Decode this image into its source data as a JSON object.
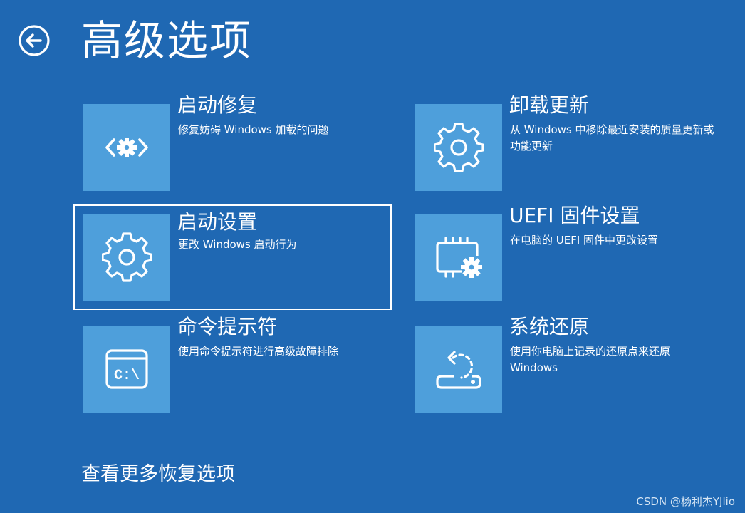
{
  "header": {
    "title": "高级选项",
    "back_icon": "arrow-left-circle-icon"
  },
  "options": [
    {
      "title": "启动修复",
      "description": "修复妨碍 Windows 加载的问题",
      "icon": "startup-repair-icon",
      "selected": false
    },
    {
      "title": "卸载更新",
      "description": "从 Windows 中移除最近安装的质量更新或功能更新",
      "icon": "gear-icon",
      "selected": false
    },
    {
      "title": "启动设置",
      "description": "更改 Windows 启动行为",
      "icon": "gear-icon",
      "selected": true
    },
    {
      "title": "UEFI 固件设置",
      "description": "在电脑的 UEFI 固件中更改设置",
      "icon": "chip-gear-icon",
      "selected": false
    },
    {
      "title": "命令提示符",
      "description": "使用命令提示符进行高级故障排除",
      "icon": "command-prompt-icon",
      "selected": false
    },
    {
      "title": "系统还原",
      "description": "使用你电脑上记录的还原点来还原 Windows",
      "icon": "system-restore-icon",
      "selected": false
    }
  ],
  "footer": {
    "more_options_link": "查看更多恢复选项"
  },
  "watermark": "CSDN @杨利杰YJlio",
  "colors": {
    "background": "#1f68b3",
    "tile": "#4e9fdb",
    "text": "#ffffff",
    "selection_border": "#ffffff"
  }
}
